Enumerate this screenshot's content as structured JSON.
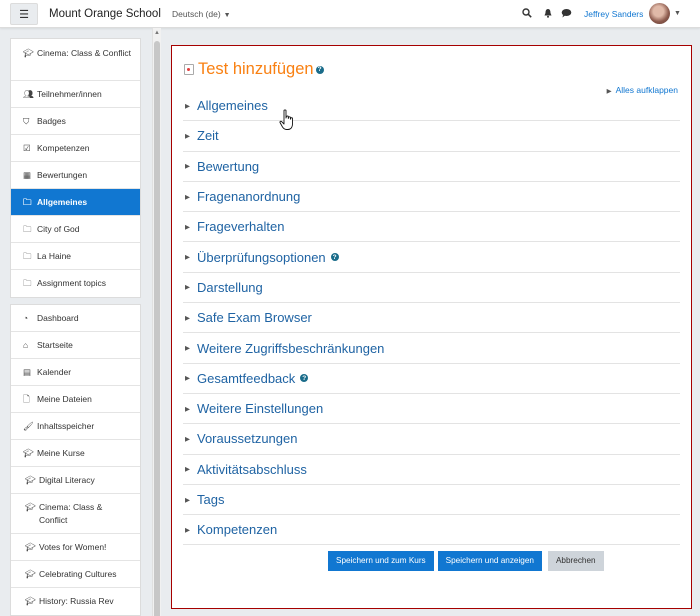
{
  "navbar": {
    "menu_icon": "hamburger-icon",
    "site_name": "Mount Orange School",
    "language": "Deutsch (de)",
    "icons": [
      "search-icon",
      "bell-icon",
      "chat-icon"
    ],
    "user_name": "Jeffrey Sanders"
  },
  "sidebar": {
    "course_nav": [
      {
        "icon": "graduation-cap-icon",
        "label": "Cinema: Class & Conflict"
      },
      {
        "icon": "users-icon",
        "label": "Teilnehmer/innen"
      },
      {
        "icon": "shield-icon",
        "label": "Badges"
      },
      {
        "icon": "checkbox-icon",
        "label": "Kompetenzen"
      },
      {
        "icon": "table-icon",
        "label": "Bewertungen"
      },
      {
        "icon": "folder-icon",
        "label": "Allgemeines",
        "active": true
      },
      {
        "icon": "folder-icon",
        "label": "City of God"
      },
      {
        "icon": "folder-icon",
        "label": "La Haine"
      },
      {
        "icon": "folder-icon",
        "label": "Assignment topics"
      }
    ],
    "site_nav": [
      {
        "icon": "dashboard-icon",
        "label": "Dashboard"
      },
      {
        "icon": "home-icon",
        "label": "Startseite"
      },
      {
        "icon": "calendar-icon",
        "label": "Kalender"
      },
      {
        "icon": "file-icon",
        "label": "Meine Dateien"
      },
      {
        "icon": "brush-icon",
        "label": "Inhaltsspeicher"
      },
      {
        "icon": "graduation-cap-icon",
        "label": "Meine Kurse"
      },
      {
        "icon": "graduation-cap-icon",
        "label": "Digital Literacy"
      },
      {
        "icon": "graduation-cap-icon",
        "label": "Cinema: Class & Conflict"
      },
      {
        "icon": "graduation-cap-icon",
        "label": "Votes for Women!"
      },
      {
        "icon": "graduation-cap-icon",
        "label": "Celebrating Cultures"
      },
      {
        "icon": "graduation-cap-icon",
        "label": "History: Russia Rev"
      }
    ]
  },
  "main": {
    "title": "Test hinzufügen",
    "expand_all": "Alles aufklappen",
    "sections": [
      {
        "label": "Allgemeines",
        "help": false
      },
      {
        "label": "Zeit",
        "help": false
      },
      {
        "label": "Bewertung",
        "help": false
      },
      {
        "label": "Fragenanordnung",
        "help": false
      },
      {
        "label": "Frageverhalten",
        "help": false
      },
      {
        "label": "Überprüfungsoptionen",
        "help": true
      },
      {
        "label": "Darstellung",
        "help": false
      },
      {
        "label": "Safe Exam Browser",
        "help": false
      },
      {
        "label": "Weitere Zugriffsbeschränkungen",
        "help": false
      },
      {
        "label": "Gesamtfeedback",
        "help": true
      },
      {
        "label": "Weitere Einstellungen",
        "help": false
      },
      {
        "label": "Voraussetzungen",
        "help": false
      },
      {
        "label": "Aktivitätsabschluss",
        "help": false
      },
      {
        "label": "Tags",
        "help": false
      },
      {
        "label": "Kompetenzen",
        "help": false
      }
    ],
    "buttons": {
      "save_return": "Speichern und zum Kurs",
      "save_display": "Speichern und anzeigen",
      "cancel": "Abbrechen"
    }
  },
  "colors": {
    "accent": "#1177d1",
    "title_orange": "#f98012",
    "card_border": "#a60000",
    "section_link": "#1f63a3"
  }
}
